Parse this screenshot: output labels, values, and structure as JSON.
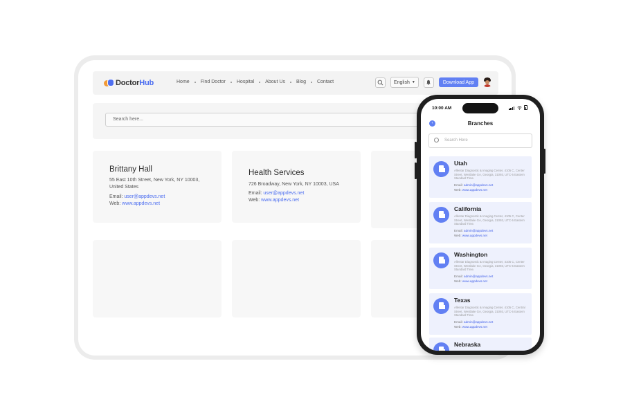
{
  "header": {
    "logo_prefix": "Doctor",
    "logo_suffix": "Hub",
    "nav": [
      "Home",
      "Find Doctor",
      "Hospital",
      "About Us",
      "Blog",
      "Contact"
    ],
    "language": "English",
    "download_label": "Download App"
  },
  "search": {
    "placeholder": "Search here..."
  },
  "cards": [
    {
      "name": "Brittany Hall",
      "address_line1": "55 East 10th Street, New York, NY 10003,",
      "address_line2": "United States",
      "email_label": "Email: ",
      "email": "user@appdevs.net",
      "web_label": "Web: ",
      "web": "www.appdevs.net"
    },
    {
      "name": "Health Services",
      "address_line1": "726 Broadway, New York, NY 10003, USA",
      "email_label": "Email: ",
      "email": "user@appdevs.net",
      "web_label": "Web: ",
      "web": "www.appdevs.net"
    }
  ],
  "phone": {
    "time": "10:00 AM",
    "title": "Branches",
    "search_placeholder": "Search Here",
    "branches": [
      {
        "name": "Utah",
        "desc": "Allentar Diagnostic & Imaging Center, 4105 C, Center Street, Westlake GA, Georgia, 31093, UTC-5 Eastern Standard Time.",
        "email_label": "Email: ",
        "email": "admin@appdevs.net",
        "web_label": "Web: ",
        "web": "www.appdevs.net"
      },
      {
        "name": "California",
        "desc": "Allentar Diagnostic & Imaging Center, 4105 C, Center Street, Westlake GA, Georgia, 31093, UTC-5 Eastern Standard Time.",
        "email_label": "Email: ",
        "email": "admin@appdevs.net",
        "web_label": "Web: ",
        "web": "www.appdevs.net"
      },
      {
        "name": "Washington",
        "desc": "Allentar Diagnostic & Imaging Center, 4105 C, Center Street, Westlake GA, Georgia, 31093, UTC-5 Eastern Standard Time.",
        "email_label": "Email: ",
        "email": "admin@appdevs.net",
        "web_label": "Web: ",
        "web": "www.appdevs.net"
      },
      {
        "name": "Texas",
        "desc": "Allentar Diagnostic & Imaging Center, 4105 C, Central Street, Westlake GA, Georgia, 31093, UTC-5 Eastern Standard Time.",
        "email_label": "Email: ",
        "email": "admin@appdevs.net",
        "web_label": "Web: ",
        "web": "www.appdevs.net"
      },
      {
        "name": "Nebraska"
      }
    ]
  },
  "colors": {
    "accent": "#6280f3",
    "logo_orange": "#f29a36",
    "link": "#4a6cf0"
  }
}
